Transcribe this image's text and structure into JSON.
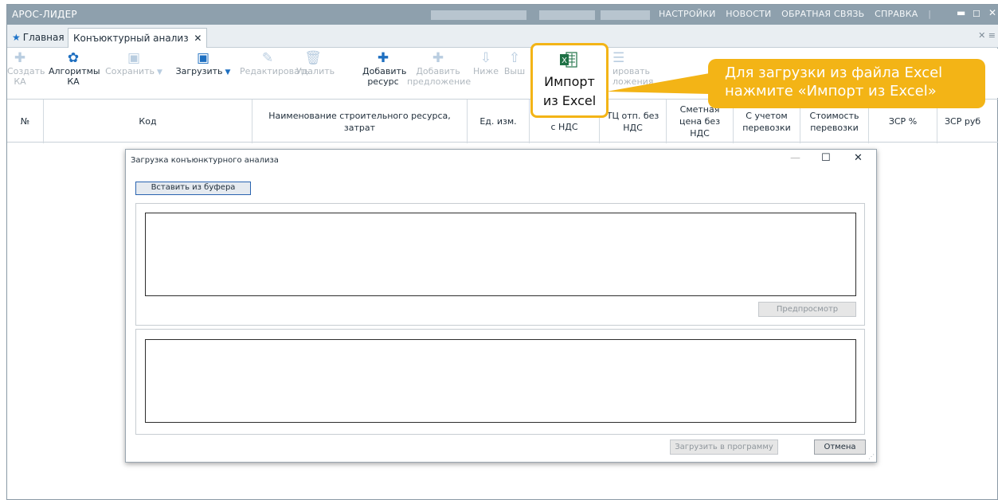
{
  "app": {
    "title": "АРОС-ЛИДЕР",
    "menu": [
      "НАСТРОЙКИ",
      "НОВОСТИ",
      "ОБРАТНАЯ СВЯЗЬ",
      "СПРАВКА"
    ],
    "separator": "|"
  },
  "tabs": [
    {
      "label": "Главная",
      "icon": "star-icon"
    },
    {
      "label": "Конъюктурный анализ",
      "close": "✕"
    }
  ],
  "toolbar": {
    "create": {
      "label1": "Создать",
      "label2": "КА",
      "icon": "plus-icon"
    },
    "algorithms": {
      "label1": "Алгоритмы",
      "label2": "КА",
      "icon": "gear-icon"
    },
    "save": {
      "label": "Сохранить",
      "icon": "save-icon"
    },
    "load": {
      "label": "Загрузить",
      "icon": "load-icon"
    },
    "edit": {
      "label": "Редактировать",
      "icon": "pencil-icon"
    },
    "delete": {
      "label": "Удалить",
      "icon": "trash-icon"
    },
    "add_resource": {
      "label1": "Добавить",
      "label2": "ресурс",
      "icon": "plus-icon"
    },
    "add_offer": {
      "label1": "Добавить",
      "label2": "предложение",
      "icon": "plus-icon"
    },
    "lower": {
      "label": "Ниже"
    },
    "higher": {
      "label": "Выш"
    },
    "group": {
      "label1": "ировать",
      "label2": "ложения"
    }
  },
  "columns": [
    {
      "label": "№"
    },
    {
      "label": "Код"
    },
    {
      "label": "Наименование строительного ресурса, затрат"
    },
    {
      "label": "Ед. изм."
    },
    {
      "label": "с НДС"
    },
    {
      "label": "ТЦ отп. без НДС"
    },
    {
      "label": "Сметная цена без НДС"
    },
    {
      "label": "С учетом перевозки"
    },
    {
      "label": "Стоимость перевозки"
    },
    {
      "label": "ЗСР %"
    },
    {
      "label": "ЗСР руб"
    }
  ],
  "dialog": {
    "title": "Загрузка конъюнктурного анализа",
    "paste_button": "Вставить из буфера",
    "preview_button": "Предпросмотр",
    "load_button": "Загрузить в программу",
    "cancel_button": "Отмена",
    "minimize": "—",
    "maximize": "☐",
    "close": "✕"
  },
  "highlight": {
    "line1": "Импорт",
    "line2": "из Excel",
    "icon": "excel-icon",
    "icon_text": "X"
  },
  "callout": {
    "line1": "Для загрузки из файла Excel",
    "line2": "нажмите «Импорт из Excel»"
  },
  "colors": {
    "accent": "#f3b416",
    "titlebar": "#8ea0ad",
    "toolbar_icon": "#1e6fc0",
    "excel_green": "#1e7145"
  }
}
